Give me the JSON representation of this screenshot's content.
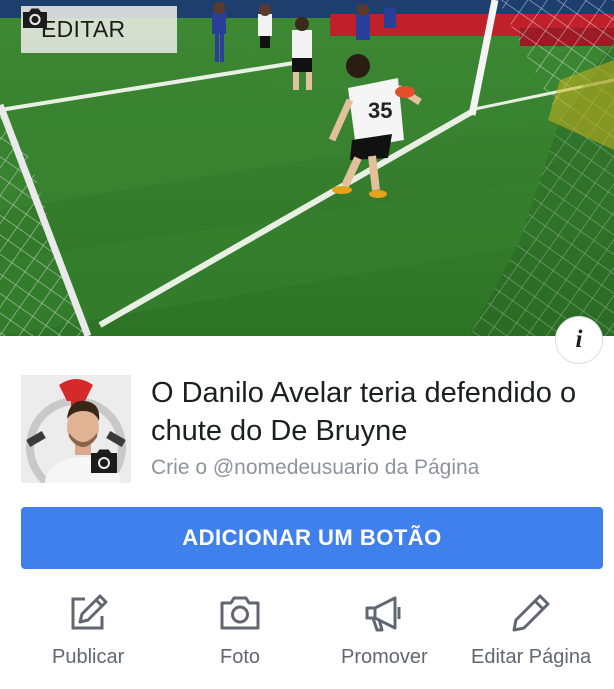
{
  "cover": {
    "edit_label": "EDITAR",
    "info_label": "i"
  },
  "page": {
    "name": "O Danilo Avelar teria defendido o chute do De Bruyne",
    "username_hint": "Crie o @nomedeusuario da Página"
  },
  "cta": {
    "label": "ADICIONAR UM BOTÃO"
  },
  "actions": [
    {
      "label": "Publicar",
      "icon": "pencil-square-icon"
    },
    {
      "label": "Foto",
      "icon": "camera-icon"
    },
    {
      "label": "Promover",
      "icon": "megaphone-icon"
    },
    {
      "label": "Editar Página",
      "icon": "pencil-icon"
    }
  ],
  "colors": {
    "accent": "#4080ec",
    "text_primary": "#1c1e21",
    "text_secondary": "#8d949e",
    "icon_gray": "#606770"
  }
}
